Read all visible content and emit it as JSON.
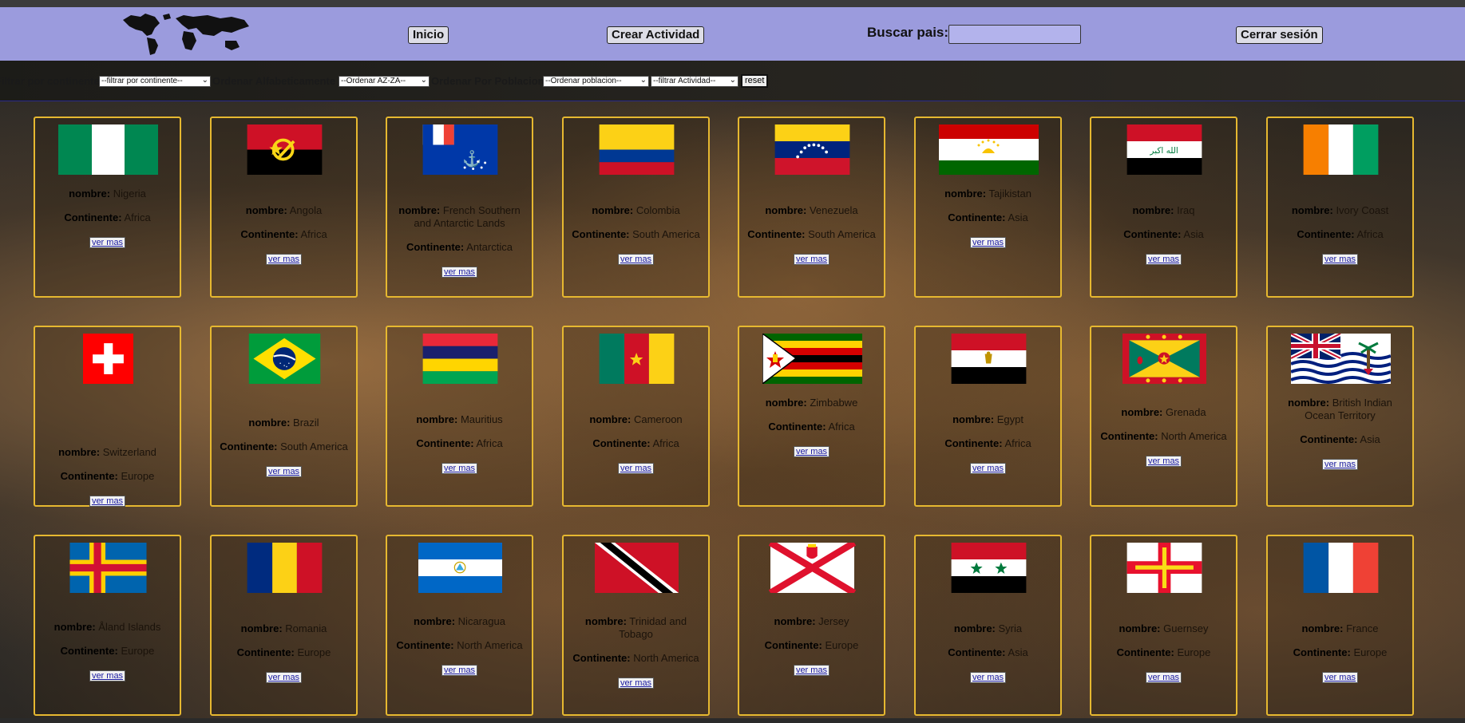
{
  "nav": {
    "logo": "world-map-logo",
    "inicio": "Inicio",
    "crear_actividad": "Crear Actividad",
    "buscar_label": "Buscar pais:",
    "buscar_value": "",
    "cerrar_sesion": "Cerrar sesión"
  },
  "filters": {
    "continente_label": "Filtrar por continente",
    "continente_value": "--filtrar por continente--",
    "alfabetico_label": "Ordenar Alfabeticamente",
    "alfabetico_value": "--Ordenar AZ-ZA--",
    "poblacion_label": "Ordenar Por Poblacion",
    "poblacion_value": "--Ordenar poblacion--",
    "actividad_value": "--filtrar Actividad--",
    "reset": "reset"
  },
  "labels": {
    "nombre": "nombre:",
    "continente": "Continente:",
    "ver_mas": "ver mas"
  },
  "countries": [
    {
      "name": "Nigeria",
      "continent": "Africa",
      "flag": "nigeria"
    },
    {
      "name": "Angola",
      "continent": "Africa",
      "flag": "angola"
    },
    {
      "name": "French Southern and Antarctic Lands",
      "continent": "Antarctica",
      "flag": "french-southern"
    },
    {
      "name": "Colombia",
      "continent": "South America",
      "flag": "colombia"
    },
    {
      "name": "Venezuela",
      "continent": "South America",
      "flag": "venezuela"
    },
    {
      "name": "Tajikistan",
      "continent": "Asia",
      "flag": "tajikistan"
    },
    {
      "name": "Iraq",
      "continent": "Asia",
      "flag": "iraq"
    },
    {
      "name": "Ivory Coast",
      "continent": "Africa",
      "flag": "ivory-coast"
    },
    {
      "name": "Switzerland",
      "continent": "Europe",
      "flag": "switzerland"
    },
    {
      "name": "Brazil",
      "continent": "South America",
      "flag": "brazil"
    },
    {
      "name": "Mauritius",
      "continent": "Africa",
      "flag": "mauritius"
    },
    {
      "name": "Cameroon",
      "continent": "Africa",
      "flag": "cameroon"
    },
    {
      "name": "Zimbabwe",
      "continent": "Africa",
      "flag": "zimbabwe"
    },
    {
      "name": "Egypt",
      "continent": "Africa",
      "flag": "egypt"
    },
    {
      "name": "Grenada",
      "continent": "North America",
      "flag": "grenada"
    },
    {
      "name": "British Indian Ocean Territory",
      "continent": "Asia",
      "flag": "british-indian-ocean"
    },
    {
      "name": "Åland Islands",
      "continent": "Europe",
      "flag": "aland"
    },
    {
      "name": "Romania",
      "continent": "Europe",
      "flag": "romania"
    },
    {
      "name": "Nicaragua",
      "continent": "North America",
      "flag": "nicaragua"
    },
    {
      "name": "Trinidad and Tobago",
      "continent": "North America",
      "flag": "trinidad-tobago"
    },
    {
      "name": "Jersey",
      "continent": "Europe",
      "flag": "jersey"
    },
    {
      "name": "Syria",
      "continent": "Asia",
      "flag": "syria"
    },
    {
      "name": "Guernsey",
      "continent": "Europe",
      "flag": "guernsey"
    },
    {
      "name": "France",
      "continent": "Europe",
      "flag": "france"
    }
  ]
}
